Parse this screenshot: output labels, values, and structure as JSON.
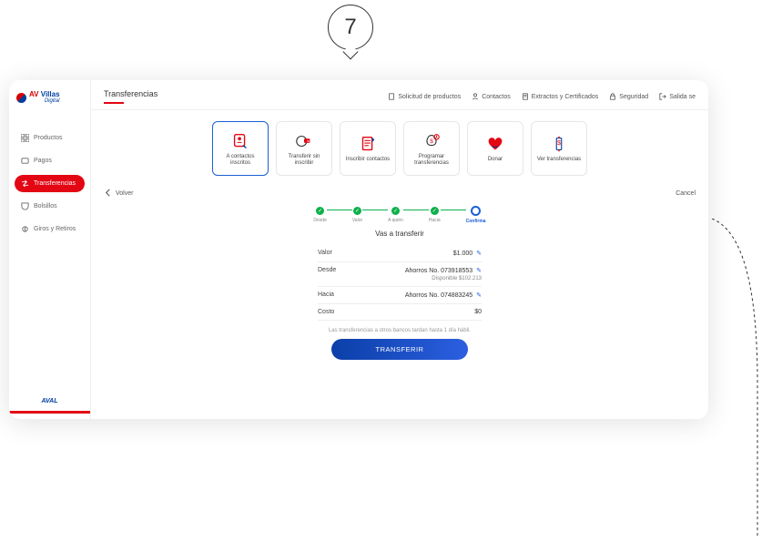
{
  "step_number": "7",
  "logo": {
    "brand_red": "AV",
    "brand_blue": "Villas",
    "sub": "Digital"
  },
  "page_title": "Transferencias",
  "top_links": [
    {
      "label": "Solicitud de productos",
      "icon": "document-icon"
    },
    {
      "label": "Contactos",
      "icon": "contacts-icon"
    },
    {
      "label": "Extractos y Certificados",
      "icon": "file-icon"
    },
    {
      "label": "Seguridad",
      "icon": "lock-icon"
    },
    {
      "label": "Salida se",
      "icon": "logout-icon"
    }
  ],
  "sidebar": {
    "items": [
      {
        "label": "Productos",
        "icon": "grid-icon",
        "active": false
      },
      {
        "label": "Pagos",
        "icon": "wallet-icon",
        "active": false
      },
      {
        "label": "Transferencias",
        "icon": "transfer-icon",
        "active": true
      },
      {
        "label": "Bolsillos",
        "icon": "pocket-icon",
        "active": false
      },
      {
        "label": "Giros y Retiros",
        "icon": "withdraw-icon",
        "active": false
      }
    ]
  },
  "footer_brand": "AVAL",
  "actions": [
    {
      "label": "A contactos inscritos",
      "icon": "contact-card-icon",
      "active": true
    },
    {
      "label": "Transferir sin inscribir",
      "icon": "transfer-quick-icon",
      "active": false
    },
    {
      "label": "Inscribir contactos",
      "icon": "clipboard-icon",
      "active": false
    },
    {
      "label": "Programar transferencias",
      "icon": "bag-icon",
      "active": false
    },
    {
      "label": "Donar",
      "icon": "heart-icon",
      "active": false
    },
    {
      "label": "Ver transferencias",
      "icon": "list-icon",
      "active": false
    }
  ],
  "back_label": "Volver",
  "cancel_label": "Cancel",
  "stepper": {
    "steps": [
      "Desde",
      "Valor",
      "A quién",
      "Hacia",
      "Confirma"
    ],
    "current_index": 4
  },
  "summary": {
    "title": "Vas a transferir",
    "rows": {
      "valor": {
        "label": "Valor",
        "value": "$1.000"
      },
      "desde": {
        "label": "Desde",
        "line1": "Ahorros No. 073918553",
        "line2": "Disponible $102.213"
      },
      "hacia": {
        "label": "Hacia",
        "value": "Ahorros No. 074883245"
      },
      "costo": {
        "label": "Costo",
        "value": "$0"
      }
    },
    "hint": "Las transferencias a otros bancos tardan hasta 1 día hábil.",
    "button": "TRANSFERIR"
  }
}
